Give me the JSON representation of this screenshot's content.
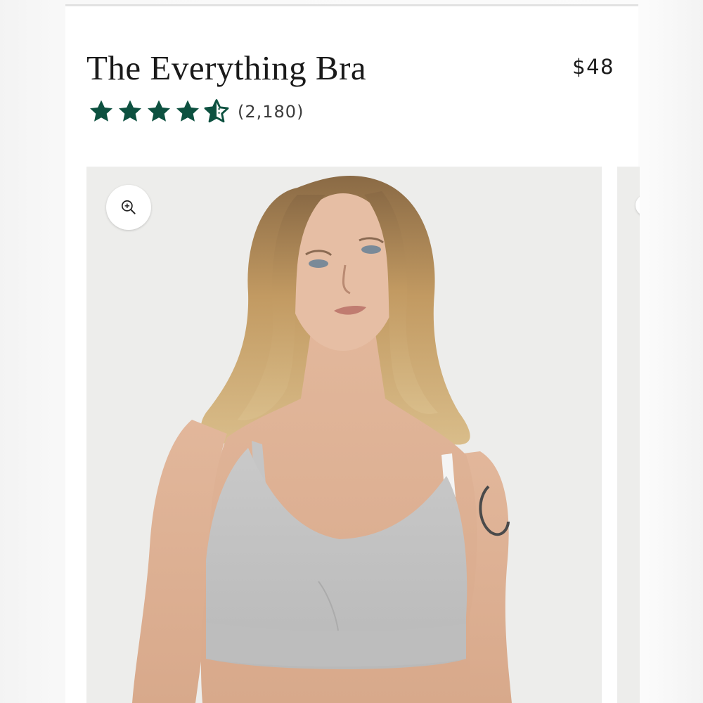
{
  "product": {
    "title": "The Everything Bra",
    "price": "$48",
    "rating": {
      "stars": 4.5,
      "max_stars": 5,
      "review_count": "(2,180)"
    }
  },
  "gallery": {
    "zoom_icon": "zoom-in-icon",
    "main_image": "product-photo-model",
    "next_image": "product-photo-next"
  },
  "colors": {
    "star": "#0d5140",
    "text": "#1a1a1a",
    "photo_background": "#ededeb"
  }
}
